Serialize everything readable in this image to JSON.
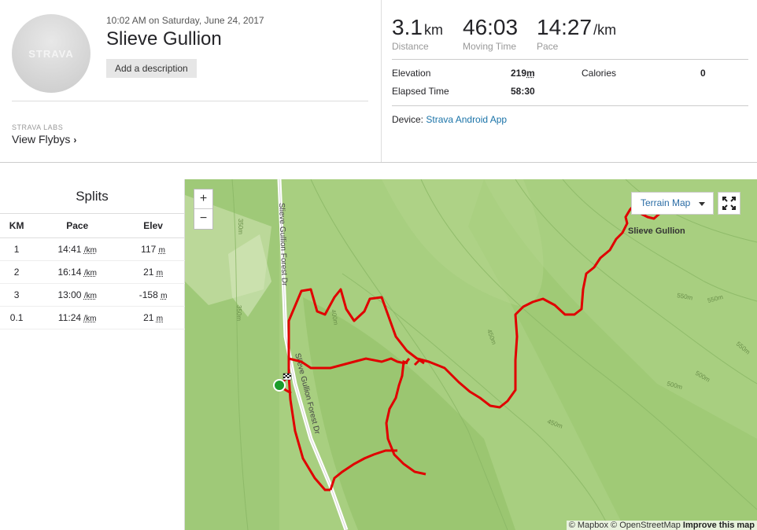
{
  "activity": {
    "logo_text": "STRAVA",
    "datetime": "10:02 AM on Saturday, June 24, 2017",
    "title": "Slieve Gullion",
    "add_description": "Add a description",
    "labs_label": "STRAVA LABS",
    "flybys_label": "View Flybys"
  },
  "stats": {
    "distance": {
      "value": "3.1",
      "unit": "km",
      "label": "Distance"
    },
    "moving_time": {
      "value": "46:03",
      "label": "Moving Time"
    },
    "pace": {
      "value": "14:27",
      "unit": "/km",
      "label": "Pace"
    }
  },
  "details": {
    "elevation_label": "Elevation",
    "elevation_value": "219",
    "elevation_unit": "m",
    "calories_label": "Calories",
    "calories_value": "0",
    "elapsed_label": "Elapsed Time",
    "elapsed_value": "58:30",
    "device_label": "Device:",
    "device_value": "Strava Android App"
  },
  "splits": {
    "title": "Splits",
    "headers": [
      "KM",
      "Pace",
      "Elev"
    ],
    "pace_unit": "/km",
    "elev_unit": "m",
    "rows": [
      {
        "km": "1",
        "pace": "14:41",
        "elev": "117"
      },
      {
        "km": "2",
        "pace": "16:14",
        "elev": "21"
      },
      {
        "km": "3",
        "pace": "13:00",
        "elev": "-158"
      },
      {
        "km": "0.1",
        "pace": "11:24",
        "elev": "21"
      }
    ]
  },
  "map": {
    "zoom_in": "+",
    "zoom_out": "−",
    "terrain_label": "Terrain Map",
    "road_label_1": "Slieve Gullion Forest Dr",
    "road_label_2": "Slieve Gullion Forest Dr",
    "peak_label": "Slieve Gullion",
    "contours": [
      "350m",
      "350m",
      "400m",
      "450m",
      "450m",
      "500m",
      "500m",
      "550m",
      "550m",
      "550m"
    ],
    "attribution_1": "© Mapbox © OpenStreetMap",
    "attribution_2": "Improve this map",
    "colors": {
      "route": "#e00000",
      "start": "#1a9c2a",
      "terrain": "#a8cf80",
      "road": "#ffffff"
    }
  }
}
